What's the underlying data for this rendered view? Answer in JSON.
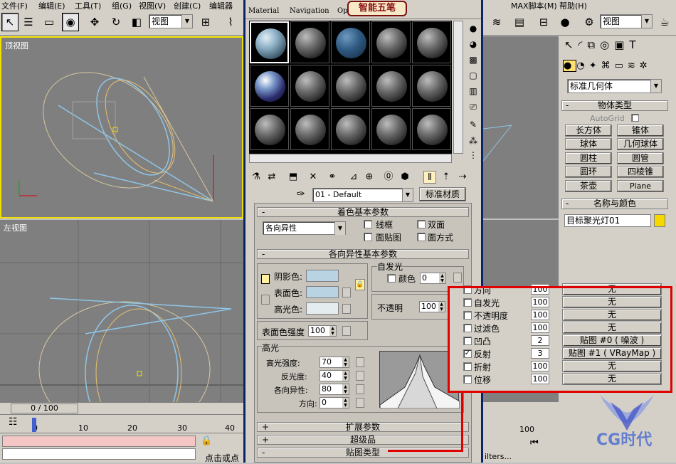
{
  "menu": [
    "文件(F)",
    "编辑(E)",
    "工具(T)",
    "组(G)",
    "视图(V)",
    "创建(C)",
    "编辑器",
    "MAX脚本(M)",
    "帮助(H)"
  ],
  "toolbar": {
    "view_select": "视图",
    "view_select_right": "视图"
  },
  "viewports": {
    "top_label": "顶视图",
    "left_label": "左视图"
  },
  "timeline": {
    "frame": "0 / 100",
    "ticks": [
      "0",
      "10",
      "20",
      "30",
      "40",
      "100"
    ]
  },
  "status": {
    "hint": "点击或点",
    "filters": "ilters...",
    "watermark": "CG时代"
  },
  "material_editor": {
    "menu": [
      "Material",
      "Navigation",
      "Op"
    ],
    "logo": "智能五笔",
    "material_name": "01 - Default",
    "material_type": "标准材质",
    "rollouts": {
      "shader_basic": "着色基本参数",
      "aniso_basic": "各向异性基本参数",
      "extended": "扩展参数",
      "super": "超级品",
      "maps": "贴图类型"
    },
    "shader": {
      "type": "各向异性",
      "wire": "线框",
      "two_sided": "双面",
      "face_map": "面贴图",
      "faceted": "面方式"
    },
    "colors": {
      "ambient": "阴影色:",
      "diffuse": "表面色:",
      "specular": "高光色:"
    },
    "self_illum": {
      "title": "自发光",
      "color_label": "颜色",
      "value": "0"
    },
    "opacity": {
      "label": "不透明",
      "value": "100"
    },
    "diffuse_level": {
      "label": "表面色强度",
      "value": "100"
    },
    "highlight": {
      "title": "高光",
      "rows": [
        {
          "label": "高光强度:",
          "value": "70"
        },
        {
          "label": "反光度:",
          "value": "40"
        },
        {
          "label": "各向异性:",
          "value": "80"
        },
        {
          "label": "方向:",
          "value": "0"
        }
      ]
    }
  },
  "command_panel": {
    "category": "标准几何体",
    "object_type_title": "物体类型",
    "autogrid": "AutoGrid",
    "buttons": [
      "长方体",
      "锥体",
      "球体",
      "几何球体",
      "圆柱",
      "圆管",
      "圆环",
      "四棱锥",
      "茶壶",
      "Plane"
    ],
    "name_color_title": "名称与颜色",
    "object_name": "目标聚光灯01",
    "object_color": "#f5d800"
  },
  "maps": [
    {
      "name": "方向",
      "amount": "100",
      "map": "无",
      "checked": false
    },
    {
      "name": "自发光",
      "amount": "100",
      "map": "无",
      "checked": false
    },
    {
      "name": "不透明度",
      "amount": "100",
      "map": "无",
      "checked": false
    },
    {
      "name": "过滤色",
      "amount": "100",
      "map": "无",
      "checked": false
    },
    {
      "name": "凹凸",
      "amount": "2",
      "map": "贴图 #0  ( 噪波 )",
      "checked": false
    },
    {
      "name": "反射",
      "amount": "3",
      "map": "贴图 #1  ( VRayMap )",
      "checked": true
    },
    {
      "name": "折射",
      "amount": "100",
      "map": "无",
      "checked": false
    },
    {
      "name": "位移",
      "amount": "100",
      "map": "无",
      "checked": false
    }
  ],
  "accent_colors": {
    "highlight_box": "#e00000",
    "title_bar": "#0a246a"
  }
}
